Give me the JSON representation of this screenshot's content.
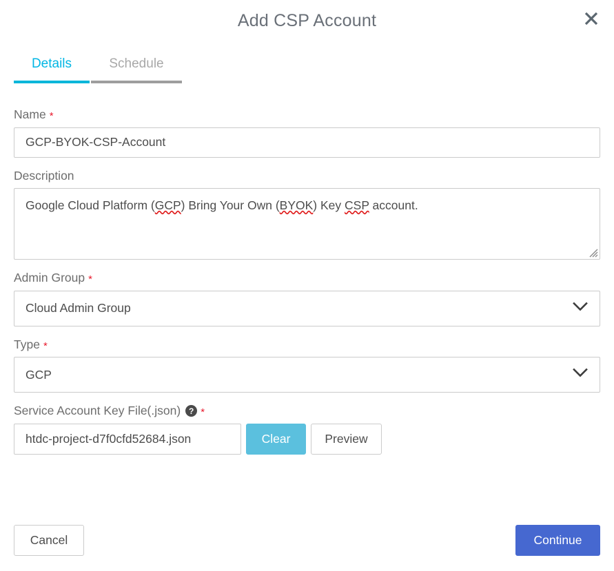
{
  "dialog": {
    "title": "Add CSP Account",
    "close_icon": "close-icon"
  },
  "tabs": [
    {
      "label": "Details",
      "active": true
    },
    {
      "label": "Schedule",
      "active": false
    }
  ],
  "form": {
    "required_marker": "*",
    "name": {
      "label": "Name",
      "value": "GCP-BYOK-CSP-Account",
      "placeholder": ""
    },
    "description": {
      "label": "Description",
      "value": "Google Cloud Platform (GCP) Bring Your Own (BYOK) Key CSP account.",
      "segments": [
        {
          "text": "Google Cloud Platform (",
          "misspelled": false
        },
        {
          "text": "GCP",
          "misspelled": true
        },
        {
          "text": ") Bring Your Own (",
          "misspelled": false
        },
        {
          "text": "BYOK",
          "misspelled": true
        },
        {
          "text": ") Key ",
          "misspelled": false
        },
        {
          "text": "CSP",
          "misspelled": true
        },
        {
          "text": " account.",
          "misspelled": false
        }
      ],
      "placeholder": ""
    },
    "admin_group": {
      "label": "Admin Group",
      "value": "Cloud Admin Group",
      "chevron_icon": "chevron-down-icon"
    },
    "type": {
      "label": "Type",
      "value": "GCP",
      "chevron_icon": "chevron-down-icon"
    },
    "service_account_key_file": {
      "label": "Service Account Key File(.json)",
      "help_icon": "help-circle-icon",
      "help_glyph": "?",
      "value": "htdc-project-d7f0cfd52684.json",
      "clear_label": "Clear",
      "preview_label": "Preview"
    }
  },
  "footer": {
    "cancel_label": "Cancel",
    "continue_label": "Continue"
  },
  "colors": {
    "accent_cyan": "#00b6da",
    "tab_inactive": "#9e9e9e",
    "clear_button": "#5bc0de",
    "continue_button": "#4668d0",
    "required_red": "#e8192c",
    "spellcheck_red": "#e02020"
  }
}
